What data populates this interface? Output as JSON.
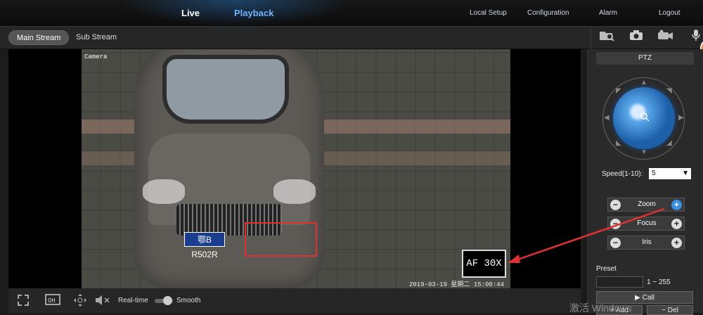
{
  "nav": {
    "live": "Live",
    "playback": "Playback",
    "local_setup": "Local Setup",
    "configuration": "Configuration",
    "alarm": "Alarm",
    "logout": "Logout"
  },
  "streams": {
    "main": "Main Stream",
    "sub": "Sub Stream"
  },
  "toolbar_icons": [
    "folder-search-icon",
    "snapshot-camera-icon",
    "record-camera-icon",
    "microphone-icon"
  ],
  "video": {
    "osd_camera": "Camera",
    "osd_timestamp": "2019-03-19  星期二  15:00:44",
    "plate_text": "鄂B R502R",
    "zoom_indicator": "AF 30X"
  },
  "controls": {
    "realtime_label": "Real-time",
    "smooth_label": "Smooth"
  },
  "ptz": {
    "title": "PTZ",
    "speed_label": "Speed(1-10):",
    "speed_value": "5",
    "zoom_label": "Zoom",
    "focus_label": "Focus",
    "iris_label": "Iris",
    "preset_label": "Preset",
    "preset_range": "1 ~ 255",
    "call_label": "Call",
    "add_label": "Add",
    "del_label": "Del"
  },
  "watermark": "激活 Windows",
  "colors": {
    "accent_blue": "#3a8fe0",
    "highlight_red": "#e03131",
    "playback_link": "#6fb4ff"
  }
}
